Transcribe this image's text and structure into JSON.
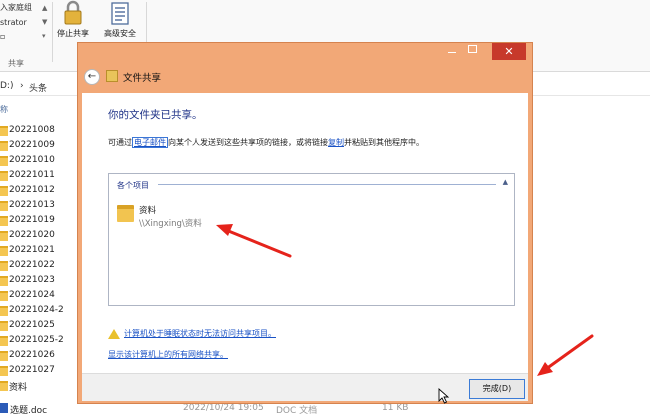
{
  "ribbon": {
    "user_line1": "入家庭组",
    "user_line2": "strator",
    "user_line3": "▫",
    "stop_share_label": "停止共享",
    "advanced_security_label": "高级安全",
    "group_label": "共享"
  },
  "address": {
    "drive": "D:)",
    "separator": "›",
    "folder": "头条"
  },
  "list_header": "称",
  "files": [
    {
      "name": "20221008"
    },
    {
      "name": "20221009"
    },
    {
      "name": "20221010"
    },
    {
      "name": "20221011"
    },
    {
      "name": "20221012"
    },
    {
      "name": "20221013"
    },
    {
      "name": "20221019"
    },
    {
      "name": "20221020"
    },
    {
      "name": "20221021"
    },
    {
      "name": "20221022"
    },
    {
      "name": "20221023"
    },
    {
      "name": "20221024"
    },
    {
      "name": "20221024-2"
    },
    {
      "name": "20221025"
    },
    {
      "name": "20221025-2"
    },
    {
      "name": "20221026"
    },
    {
      "name": "20221027"
    },
    {
      "name": "资料"
    }
  ],
  "bottom_file": {
    "name": "选题.doc",
    "date": "2022/10/24 19:05",
    "type": "DOC 文档",
    "size": "11 KB"
  },
  "dialog": {
    "window_close": "✕",
    "title": "文件共享",
    "heading": "你的文件夹已共享。",
    "desc_prefix": "可通过",
    "desc_email_link": "电子邮件",
    "desc_middle": "向某个人发送到这些共享项的链接，或将链接",
    "desc_copy_link": "复制",
    "desc_suffix": "并粘贴到其他程序中。",
    "items_header": "各个项目",
    "share_item_name": "资料",
    "share_item_path": "\\\\Xingxing\\资料",
    "warning_link": "计算机处于睡眠状态时无法访问共享项目。",
    "network_link": "显示该计算机上的所有网络共享。",
    "done_button": "完成(D)"
  },
  "colors": {
    "dialog_frame": "#f2a877",
    "close_button": "#c7392b",
    "heading_blue": "#1e3287",
    "link_blue": "#1a52c5",
    "annotation_red": "#e5231b"
  },
  "icons": {
    "back": "back-arrow-icon",
    "collapse": "chevron-up-icon",
    "warning": "warning-icon",
    "folder": "folder-icon"
  }
}
